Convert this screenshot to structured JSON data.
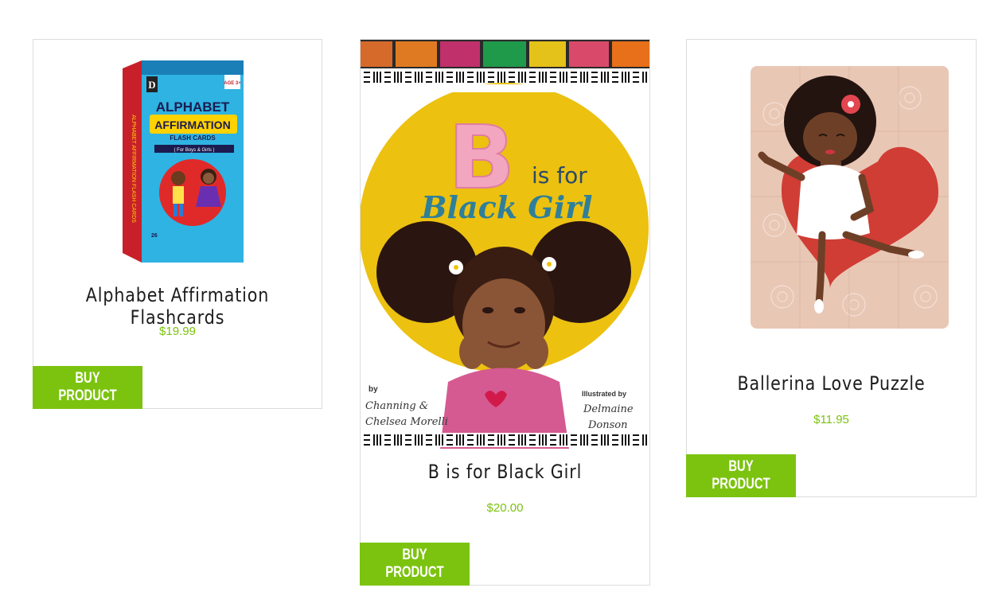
{
  "products": [
    {
      "title": "Alphabet Affirmation Flashcards",
      "price": "$19.99",
      "button": "BUY PRODUCT",
      "image": {
        "brand": "D",
        "line1": "ALPHABET",
        "line2": "AFFIRMATION",
        "line3": "FLASH CARDS",
        "line4": "( For Boys & Girls )",
        "age": "AGE 3+",
        "spine": "ALPHABET AFFIRMATION FLASH CARDS"
      }
    },
    {
      "title": "B is for Black Girl",
      "price": "$20.00",
      "button": "BUY PRODUCT",
      "image": {
        "big_letter": "B",
        "is_for": "is for",
        "name": "Black Girl",
        "by": "by",
        "authors_1": "Channing &",
        "authors_2": "Chelsea Morelli",
        "illustrated_by": "Illustrated by",
        "illustrator_1": "Delmaine",
        "illustrator_2": "Donson"
      }
    },
    {
      "title": "Ballerina Love Puzzle",
      "price": "$11.95",
      "button": "BUY PRODUCT"
    }
  ],
  "colors": {
    "accent": "#7cc30f",
    "border": "#dcdcdc",
    "title": "#1c1c1c"
  }
}
